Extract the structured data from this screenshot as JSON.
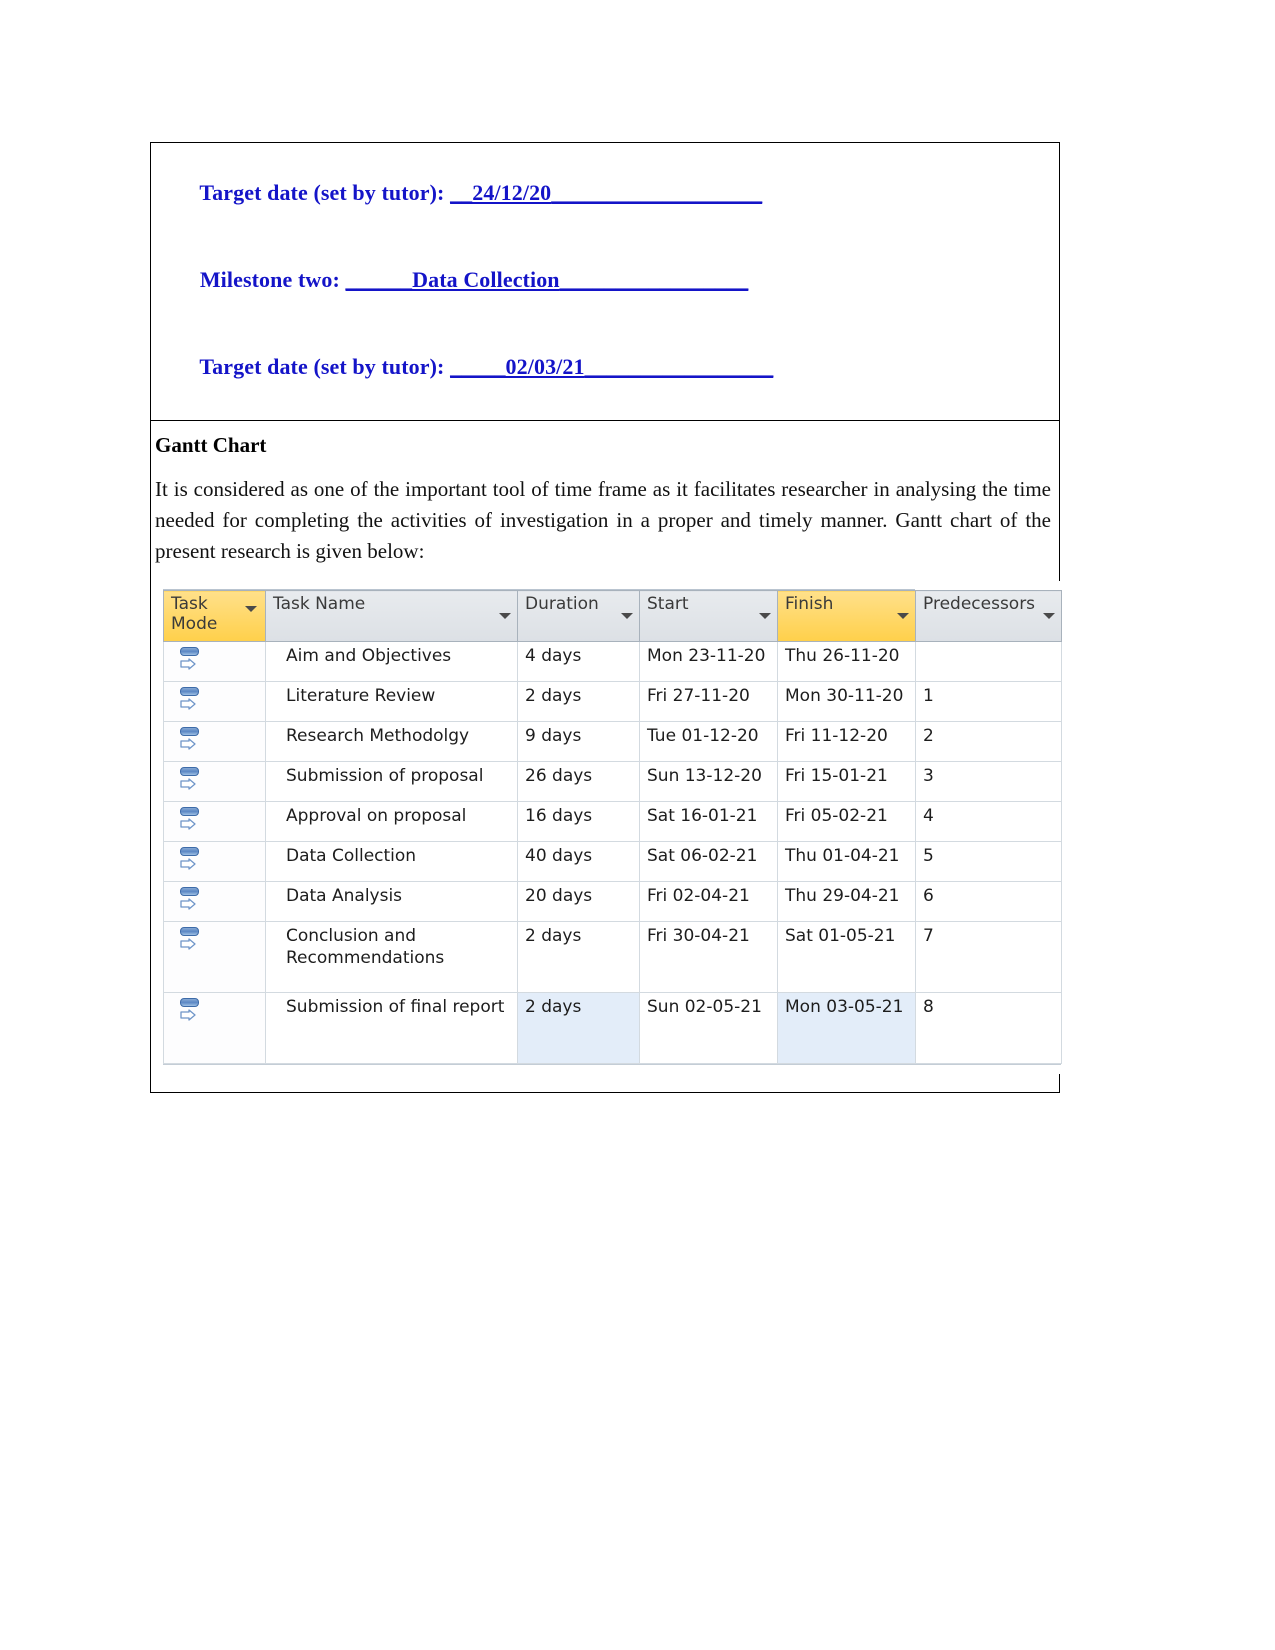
{
  "document": {
    "milestone_lines": [
      {
        "label": "Target date (set by tutor): ",
        "value": "__24/12/20",
        "trail": "___________________"
      },
      {
        "label": "Milestone two: ",
        "value": "______Data Collection",
        "trail": "_________________"
      },
      {
        "label": "Target date (set by tutor): ",
        "value": "_____02/03/21",
        "trail": "_________________"
      }
    ],
    "heading": "Gantt Chart",
    "paragraph": "It is considered as one of the important tool of time frame as it facilitates researcher in analysing the time needed for completing the activities of investigation in a proper and timely manner. Gantt chart of the present research is given below:"
  },
  "gantt_table": {
    "columns": [
      {
        "key": "task_mode",
        "label": "Task Mode",
        "highlight": true,
        "filter_icon": "filter-arrow-icon"
      },
      {
        "key": "task_name",
        "label": "Task Name",
        "highlight": false,
        "filter_icon": "filter-arrow-icon"
      },
      {
        "key": "duration",
        "label": "Duration",
        "highlight": false,
        "filter_icon": "filter-arrow-icon"
      },
      {
        "key": "start",
        "label": "Start",
        "highlight": false,
        "filter_icon": "filter-arrow-icon"
      },
      {
        "key": "finish",
        "label": "Finish",
        "highlight": true,
        "filter_icon": "filter-arrow-icon"
      },
      {
        "key": "predecessors",
        "label": "Predecessors",
        "highlight": false,
        "filter_icon": "filter-arrow-icon"
      }
    ],
    "rows": [
      {
        "mode_icon": "auto-scheduled-icon",
        "task_name": "Aim and Objectives",
        "duration": "4 days",
        "start": "Mon 23-11-20",
        "finish": "Thu 26-11-20",
        "predecessors": ""
      },
      {
        "mode_icon": "auto-scheduled-icon",
        "task_name": "Literature Review",
        "duration": "2 days",
        "start": "Fri 27-11-20",
        "finish": "Mon 30-11-20",
        "predecessors": "1"
      },
      {
        "mode_icon": "auto-scheduled-icon",
        "task_name": "Research Methodolgy",
        "duration": "9 days",
        "start": "Tue 01-12-20",
        "finish": "Fri 11-12-20",
        "predecessors": "2"
      },
      {
        "mode_icon": "auto-scheduled-icon",
        "task_name": "Submission of proposal",
        "duration": "26 days",
        "start": "Sun 13-12-20",
        "finish": "Fri 15-01-21",
        "predecessors": "3"
      },
      {
        "mode_icon": "auto-scheduled-icon",
        "task_name": "Approval on proposal",
        "duration": "16 days",
        "start": "Sat 16-01-21",
        "finish": "Fri 05-02-21",
        "predecessors": "4"
      },
      {
        "mode_icon": "auto-scheduled-icon",
        "task_name": "Data Collection",
        "duration": "40 days",
        "start": "Sat 06-02-21",
        "finish": "Thu 01-04-21",
        "predecessors": "5"
      },
      {
        "mode_icon": "auto-scheduled-icon",
        "task_name": "Data Analysis",
        "duration": "20 days",
        "start": "Fri 02-04-21",
        "finish": "Thu 29-04-21",
        "predecessors": "6"
      },
      {
        "mode_icon": "auto-scheduled-icon",
        "task_name": "Conclusion and Recommendations",
        "duration": "2 days",
        "start": "Fri 30-04-21",
        "finish": "Sat 01-05-21",
        "predecessors": "7"
      },
      {
        "mode_icon": "auto-scheduled-icon",
        "task_name": "Submission of final report",
        "duration": "2 days",
        "start": "Sun 02-05-21",
        "finish": "Mon 03-05-21",
        "predecessors": "8"
      }
    ]
  },
  "colors": {
    "milestone_text": "#1414c8",
    "header_highlight": "#ffd966",
    "header_background": "#dfe3e8",
    "selection_blue": "#e3edf9",
    "grid_line": "#c4cdd6"
  }
}
